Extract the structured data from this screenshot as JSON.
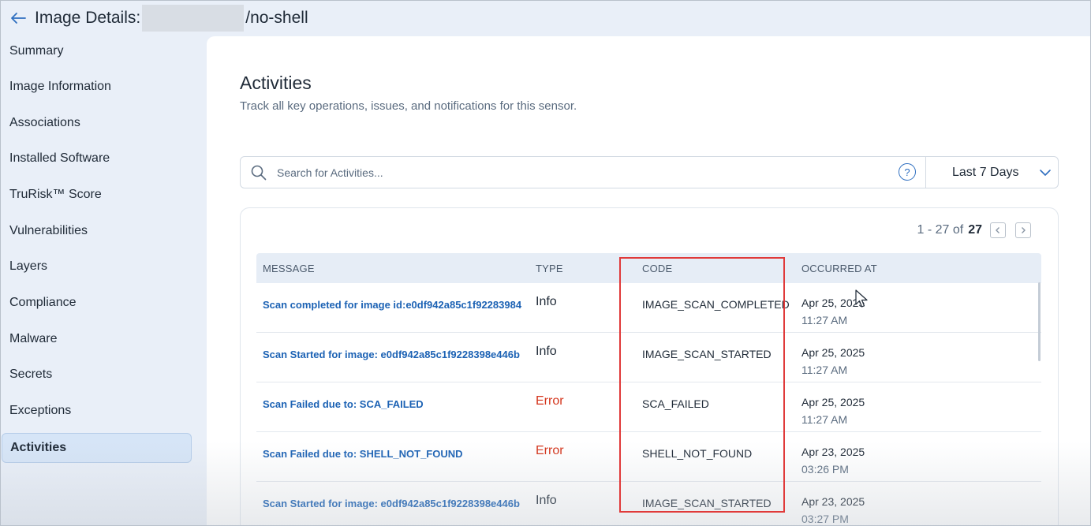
{
  "header": {
    "back_label": "←",
    "title_prefix": "Image Details:",
    "title_suffix": "/no-shell"
  },
  "sidebar": {
    "items": [
      {
        "label": "Summary"
      },
      {
        "label": "Image Information"
      },
      {
        "label": "Associations"
      },
      {
        "label": "Installed Software"
      },
      {
        "label": "TruRisk™ Score"
      },
      {
        "label": "Vulnerabilities"
      },
      {
        "label": "Layers"
      },
      {
        "label": "Compliance"
      },
      {
        "label": "Malware"
      },
      {
        "label": "Secrets"
      },
      {
        "label": "Exceptions"
      },
      {
        "label": "Activities"
      }
    ],
    "active": "Activities"
  },
  "main": {
    "title": "Activities",
    "subtitle": "Track all key operations, issues, and notifications for this sensor.",
    "search": {
      "placeholder": "Search for Activities...",
      "help_label": "?"
    },
    "range": {
      "selected": "Last 7 Days"
    },
    "pagination": {
      "range": "1 - 27 of",
      "total": "27"
    },
    "table": {
      "columns": [
        "MESSAGE",
        "TYPE",
        "CODE",
        "OCCURRED AT"
      ],
      "rows": [
        {
          "message": "Scan completed for image id:e0df942a85c1f92283984",
          "type": "Info",
          "code": "IMAGE_SCAN_COMPLETED",
          "date": "Apr 25, 2025",
          "time": "11:27 AM"
        },
        {
          "message": "Scan Started for image: e0df942a85c1f9228398e446b",
          "type": "Info",
          "code": "IMAGE_SCAN_STARTED",
          "date": "Apr 25, 2025",
          "time": "11:27 AM"
        },
        {
          "message": "Scan Failed due to: SCA_FAILED",
          "type": "Error",
          "code": "SCA_FAILED",
          "date": "Apr 25, 2025",
          "time": "11:27 AM"
        },
        {
          "message": "Scan Failed due to: SHELL_NOT_FOUND",
          "type": "Error",
          "code": "SHELL_NOT_FOUND",
          "date": "Apr 23, 2025",
          "time": "03:26 PM"
        },
        {
          "message": "Scan Started for image: e0df942a85c1f9228398e446b",
          "type": "Info",
          "code": "IMAGE_SCAN_STARTED",
          "date": "Apr 23, 2025",
          "time": "03:27 PM"
        }
      ]
    }
  },
  "colors": {
    "accent": "#2f6fc0",
    "link": "#1c62b4",
    "error": "#d4341b",
    "highlight": "#e03a3a",
    "sidebar_bg": "#e9eff8"
  },
  "icons": [
    "back-arrow-icon",
    "search-icon",
    "help-icon",
    "chevron-down-icon",
    "chevron-left-icon",
    "chevron-right-icon",
    "cursor-icon"
  ]
}
